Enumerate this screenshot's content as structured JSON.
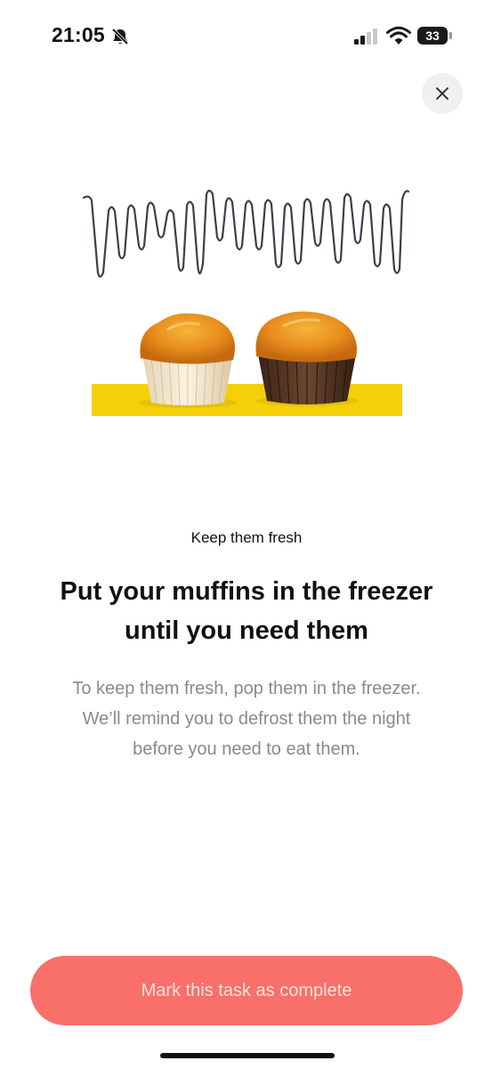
{
  "status_bar": {
    "time": "21:05",
    "battery_level": "33",
    "icons": [
      "bell-slash-icon",
      "signal-icon",
      "wifi-icon",
      "battery-icon"
    ]
  },
  "close_button": {
    "icon": "close-icon"
  },
  "illustration": {
    "description_icon": "muffins-illustration",
    "colors": {
      "stripe": "#f5cf08",
      "squiggle": "#3a3f4a"
    }
  },
  "content": {
    "eyebrow": "Keep them fresh",
    "headline_line1": "Put your muffins in the freezer",
    "headline_line2": "until you need them",
    "body_line1": "To keep them fresh, pop them in the freezer.",
    "body_line2": "We’ll remind you to defrost them the night",
    "body_line3": "before you need to eat them."
  },
  "cta": {
    "label": "Mark this task as complete",
    "color": "#f87069"
  }
}
